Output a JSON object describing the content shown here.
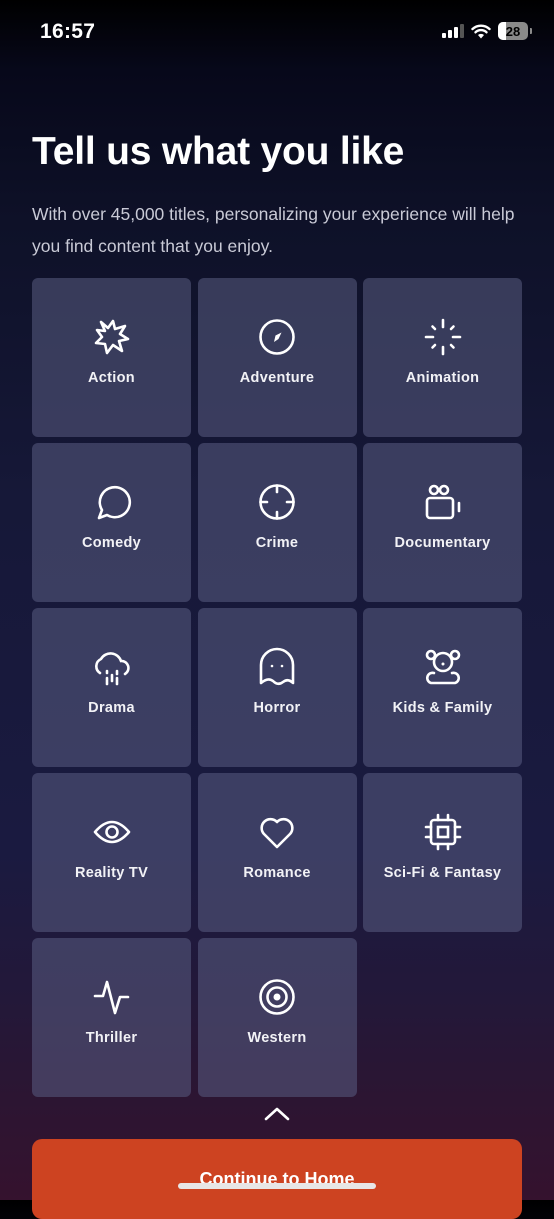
{
  "status_bar": {
    "time": "16:57",
    "battery_level": "28",
    "icons": [
      "cellular-signal-icon",
      "wifi-icon",
      "battery-icon"
    ]
  },
  "header": {
    "title": "Tell us what you like",
    "subtitle": "With over 45,000 titles, personalizing your experience will help you find content that you enjoy."
  },
  "genres": [
    {
      "label": "Action",
      "icon": "explosion-icon"
    },
    {
      "label": "Adventure",
      "icon": "compass-icon"
    },
    {
      "label": "Animation",
      "icon": "sparkle-burst-icon"
    },
    {
      "label": "Comedy",
      "icon": "speech-bubble-icon"
    },
    {
      "label": "Crime",
      "icon": "crosshair-icon"
    },
    {
      "label": "Documentary",
      "icon": "film-camera-icon"
    },
    {
      "label": "Drama",
      "icon": "rain-cloud-icon"
    },
    {
      "label": "Horror",
      "icon": "ghost-icon"
    },
    {
      "label": "Kids & Family",
      "icon": "teddy-bear-icon"
    },
    {
      "label": "Reality TV",
      "icon": "eye-icon"
    },
    {
      "label": "Romance",
      "icon": "heart-icon"
    },
    {
      "label": "Sci-Fi & Fantasy",
      "icon": "chip-icon"
    },
    {
      "label": "Thriller",
      "icon": "pulse-icon"
    },
    {
      "label": "Western",
      "icon": "target-icon"
    }
  ],
  "footer": {
    "expand_icon": "chevron-up-icon",
    "continue_label": "Continue to Home"
  },
  "colors": {
    "cta": "#cd4321",
    "tile": "#3b3c5a"
  }
}
